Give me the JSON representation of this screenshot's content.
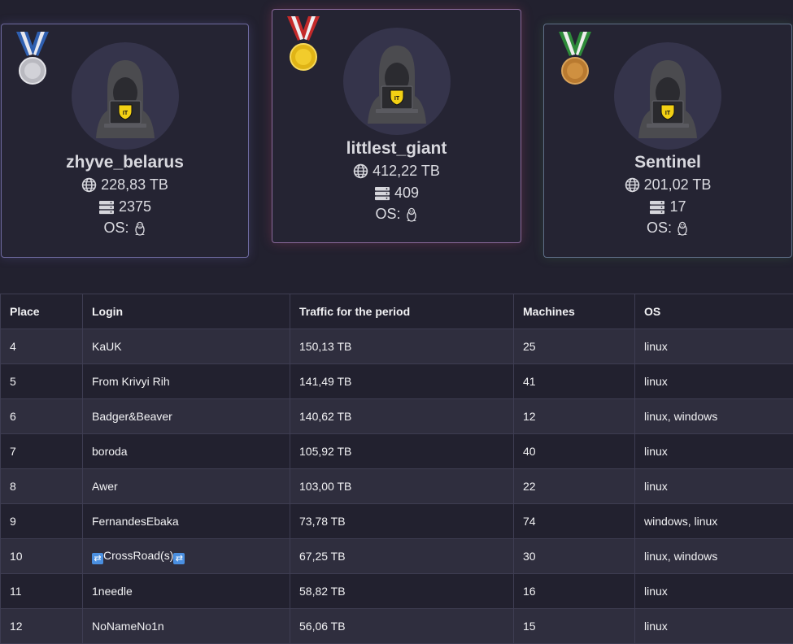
{
  "podium": [
    {
      "rank_icon": "silver-medal-icon",
      "username": "zhyve_belarus",
      "traffic": "228,83 TB",
      "machines": "2375",
      "os_label": "OS:",
      "os_icon": "linux-penguin-icon"
    },
    {
      "rank_icon": "gold-medal-icon",
      "username": "littlest_giant",
      "traffic": "412,22 TB",
      "machines": "409",
      "os_label": "OS:",
      "os_icon": "linux-penguin-icon"
    },
    {
      "rank_icon": "bronze-medal-icon",
      "username": "Sentinel",
      "traffic": "201,02 TB",
      "machines": "17",
      "os_label": "OS:",
      "os_icon": "linux-penguin-icon"
    }
  ],
  "table": {
    "headers": [
      "Place",
      "Login",
      "Traffic for the period",
      "Machines",
      "OS"
    ],
    "rows": [
      {
        "place": "4",
        "login": "KaUK",
        "traffic": "150,13 TB",
        "machines": "25",
        "os": "linux"
      },
      {
        "place": "5",
        "login": "From Krivyi Rih",
        "traffic": "141,49 TB",
        "machines": "41",
        "os": "linux"
      },
      {
        "place": "6",
        "login": "Badger&Beaver",
        "traffic": "140,62 TB",
        "machines": "12",
        "os": "linux, windows"
      },
      {
        "place": "7",
        "login": "boroda",
        "traffic": "105,92 TB",
        "machines": "40",
        "os": "linux"
      },
      {
        "place": "8",
        "login": "Awer",
        "traffic": "103,00 TB",
        "machines": "22",
        "os": "linux"
      },
      {
        "place": "9",
        "login": "FernandesEbaka",
        "traffic": "73,78 TB",
        "machines": "74",
        "os": "windows, linux"
      },
      {
        "place": "10",
        "login": "CrossRoad(s)",
        "traffic": "67,25 TB",
        "machines": "30",
        "os": "linux, windows"
      },
      {
        "place": "11",
        "login": "1needle",
        "traffic": "58,82 TB",
        "machines": "16",
        "os": "linux"
      },
      {
        "place": "12",
        "login": "NoNameNo1n",
        "traffic": "56,06 TB",
        "machines": "15",
        "os": "linux"
      }
    ]
  },
  "colors": {
    "background": "#22212f",
    "gold": "#e8c21a",
    "silver": "#c9c9cf",
    "bronze": "#c8893a"
  }
}
